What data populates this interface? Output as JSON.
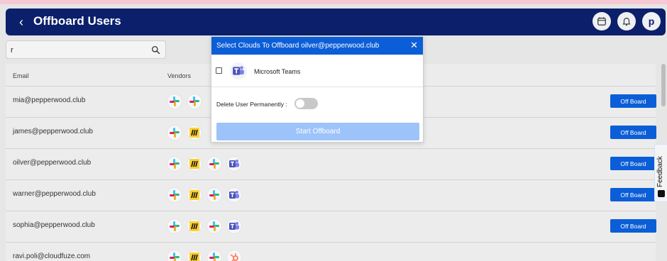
{
  "header": {
    "title": "Offboard Users",
    "back_icon": "back-chevron-icon",
    "avatar_letter": "p"
  },
  "search": {
    "value": "r",
    "icon": "search-icon"
  },
  "table": {
    "columns": {
      "email": "Email",
      "vendors": "Vendors"
    },
    "rows": [
      {
        "email": "mia@pepperwood.club",
        "action": "Off Board"
      },
      {
        "email": "james@pepperwood.club",
        "action": "Off Board"
      },
      {
        "email": "oilver@pepperwood.club",
        "action": "Off Board"
      },
      {
        "email": "warner@pepperwood.club",
        "action": "Off Board"
      },
      {
        "email": "sophia@pepperwood.club",
        "action": "Off Board"
      },
      {
        "email": "ravi.poli@cloudfuze.com",
        "action": ""
      }
    ]
  },
  "modal": {
    "title": "Select Clouds To Offboard oilver@pepperwood.club",
    "close": "✕",
    "cloud_label": "Microsoft Teams",
    "delete_label": "Delete User Permanently :",
    "start_button": "Start Offboard"
  },
  "feedback": {
    "label": "Feedback"
  },
  "colors": {
    "header_bg": "#0b1f6b",
    "primary": "#0b5ed7",
    "disabled_primary": "#9dc3fb"
  }
}
